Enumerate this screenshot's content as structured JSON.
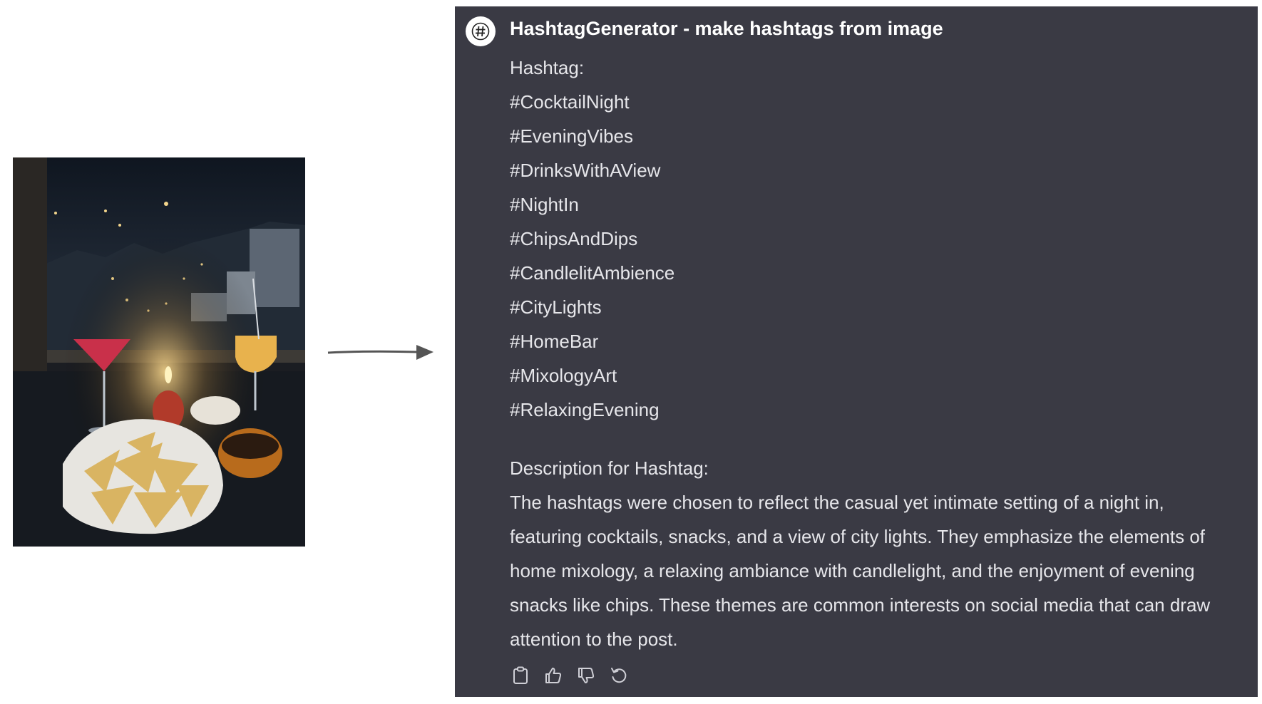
{
  "chat": {
    "bot_name": "HashtagGenerator - make hashtags from image",
    "avatar_icon": "hashtag-icon",
    "hashtag_heading": "Hashtag:",
    "hashtags": [
      "#CocktailNight",
      "#EveningVibes",
      "#DrinksWithAView",
      "#NightIn",
      "#ChipsAndDips",
      "#CandlelitAmbience",
      "#CityLights",
      "#HomeBar",
      "#MixologyArt",
      "#RelaxingEvening"
    ],
    "description_heading": "Description for Hashtag:",
    "description_lines": [
      "The hashtags were chosen to reflect the casual yet intimate setting of a night in,",
      "featuring cocktails, snacks, and a view of city lights. They emphasize the elements of",
      "home mixology, a relaxing ambiance with candlelight, and the enjoyment of evening",
      "snacks like chips. These themes are common interests on social media that can draw",
      "attention to the post."
    ],
    "actions": [
      "copy-icon",
      "thumbs-up-icon",
      "thumbs-down-icon",
      "regenerate-icon"
    ]
  },
  "colors": {
    "panel_bg": "#3a3a44",
    "text": "#e6e6ea",
    "title": "#ffffff"
  }
}
